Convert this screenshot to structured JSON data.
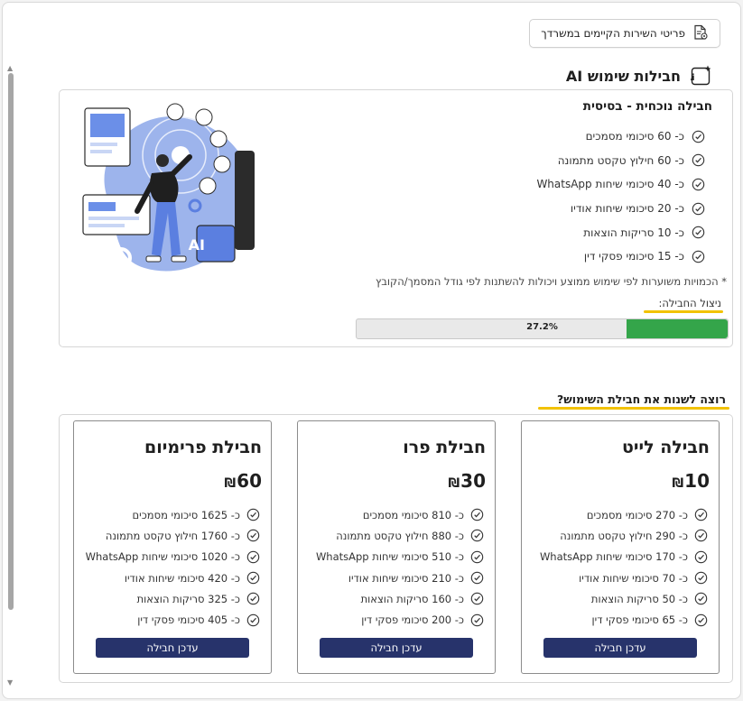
{
  "header": {
    "details_button_label": "פריטי השירות הקיימים במשרדך",
    "details_icon": "document-settings-icon"
  },
  "section": {
    "title": "חבילות שימוש AI",
    "icon": "ai-sparkle-icon"
  },
  "current_plan": {
    "title": "חבילה נוכחית - בסיסית",
    "features": [
      "כ- 60 סיכומי מסמכים",
      "כ- 60 חילוץ טקסט מתמונה",
      "כ- 40 סיכומי שיחות WhatsApp",
      "כ- 20 סיכומי שיחות אודיו",
      "כ- 10 סריקות הוצאות",
      "כ- 15 סיכומי פסקי דין"
    ],
    "note": "* הכמויות משוערות לפי שימוש ממוצע ויכולות להשתנות לפי גודל המסמך/הקובץ",
    "usage_label": "ניצול החבילה:",
    "usage_percent": 27.2,
    "usage_text": "27.2%",
    "accent_colors": {
      "progress": "#34a54a",
      "underline": "#f2c200"
    }
  },
  "change": {
    "title": "רוצה לשנות את חבילת השימוש?"
  },
  "plans": [
    {
      "name": "חבילה לייט",
      "price": "10",
      "currency": "₪",
      "features": [
        "כ- 270 סיכומי מסמכים",
        "כ- 290 חילוץ טקסט מתמונה",
        "כ- 170 סיכומי שיחות WhatsApp",
        "כ- 70 סיכומי שיחות אודיו",
        "כ- 50 סריקות הוצאות",
        "כ- 65 סיכומי פסקי דין"
      ],
      "button": "עדכן חבילה"
    },
    {
      "name": "חבילת פרו",
      "price": "30",
      "currency": "₪",
      "features": [
        "כ- 810 סיכומי מסמכים",
        "כ- 880 חילוץ טקסט מתמונה",
        "כ- 510 סיכומי שיחות WhatsApp",
        "כ- 210 סיכומי שיחות אודיו",
        "כ- 160 סריקות הוצאות",
        "כ- 200 סיכומי פסקי דין"
      ],
      "button": "עדכן חבילה"
    },
    {
      "name": "חבילת פרימיום",
      "price": "60",
      "currency": "₪",
      "features": [
        "כ- 1625 סיכומי מסמכים",
        "כ- 1760 חילוץ טקסט מתמונה",
        "כ- 1020 סיכומי שיחות WhatsApp",
        "כ- 420 סיכומי שיחות אודיו",
        "כ- 325 סריקות הוצאות",
        "כ- 405 סיכומי פסקי דין"
      ],
      "button": "עדכן חבילה"
    }
  ],
  "colors": {
    "button_bg": "#27336b",
    "check_icon": "#333333"
  }
}
